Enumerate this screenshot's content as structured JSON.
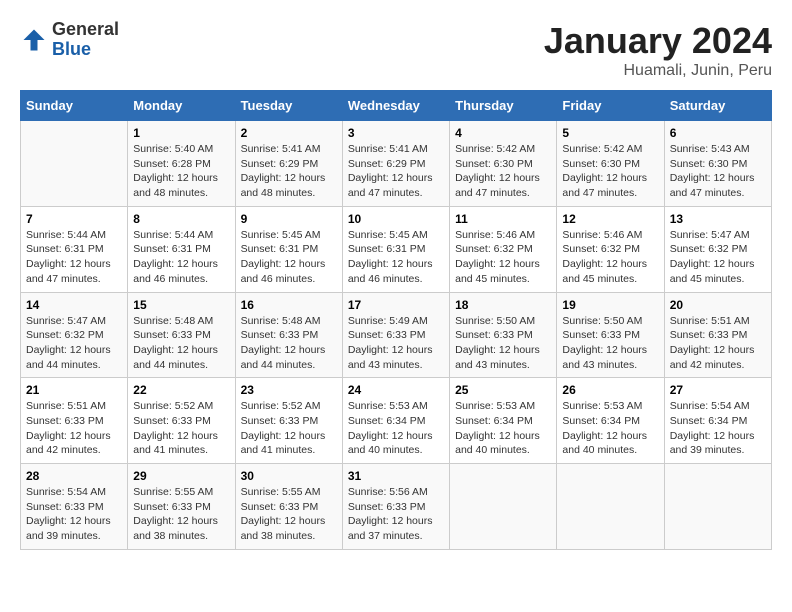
{
  "logo": {
    "general": "General",
    "blue": "Blue"
  },
  "title": "January 2024",
  "subtitle": "Huamali, Junin, Peru",
  "days_of_week": [
    "Sunday",
    "Monday",
    "Tuesday",
    "Wednesday",
    "Thursday",
    "Friday",
    "Saturday"
  ],
  "weeks": [
    [
      {
        "num": "",
        "info": ""
      },
      {
        "num": "1",
        "info": "Sunrise: 5:40 AM\nSunset: 6:28 PM\nDaylight: 12 hours\nand 48 minutes."
      },
      {
        "num": "2",
        "info": "Sunrise: 5:41 AM\nSunset: 6:29 PM\nDaylight: 12 hours\nand 48 minutes."
      },
      {
        "num": "3",
        "info": "Sunrise: 5:41 AM\nSunset: 6:29 PM\nDaylight: 12 hours\nand 47 minutes."
      },
      {
        "num": "4",
        "info": "Sunrise: 5:42 AM\nSunset: 6:30 PM\nDaylight: 12 hours\nand 47 minutes."
      },
      {
        "num": "5",
        "info": "Sunrise: 5:42 AM\nSunset: 6:30 PM\nDaylight: 12 hours\nand 47 minutes."
      },
      {
        "num": "6",
        "info": "Sunrise: 5:43 AM\nSunset: 6:30 PM\nDaylight: 12 hours\nand 47 minutes."
      }
    ],
    [
      {
        "num": "7",
        "info": "Sunrise: 5:44 AM\nSunset: 6:31 PM\nDaylight: 12 hours\nand 47 minutes."
      },
      {
        "num": "8",
        "info": "Sunrise: 5:44 AM\nSunset: 6:31 PM\nDaylight: 12 hours\nand 46 minutes."
      },
      {
        "num": "9",
        "info": "Sunrise: 5:45 AM\nSunset: 6:31 PM\nDaylight: 12 hours\nand 46 minutes."
      },
      {
        "num": "10",
        "info": "Sunrise: 5:45 AM\nSunset: 6:31 PM\nDaylight: 12 hours\nand 46 minutes."
      },
      {
        "num": "11",
        "info": "Sunrise: 5:46 AM\nSunset: 6:32 PM\nDaylight: 12 hours\nand 45 minutes."
      },
      {
        "num": "12",
        "info": "Sunrise: 5:46 AM\nSunset: 6:32 PM\nDaylight: 12 hours\nand 45 minutes."
      },
      {
        "num": "13",
        "info": "Sunrise: 5:47 AM\nSunset: 6:32 PM\nDaylight: 12 hours\nand 45 minutes."
      }
    ],
    [
      {
        "num": "14",
        "info": "Sunrise: 5:47 AM\nSunset: 6:32 PM\nDaylight: 12 hours\nand 44 minutes."
      },
      {
        "num": "15",
        "info": "Sunrise: 5:48 AM\nSunset: 6:33 PM\nDaylight: 12 hours\nand 44 minutes."
      },
      {
        "num": "16",
        "info": "Sunrise: 5:48 AM\nSunset: 6:33 PM\nDaylight: 12 hours\nand 44 minutes."
      },
      {
        "num": "17",
        "info": "Sunrise: 5:49 AM\nSunset: 6:33 PM\nDaylight: 12 hours\nand 43 minutes."
      },
      {
        "num": "18",
        "info": "Sunrise: 5:50 AM\nSunset: 6:33 PM\nDaylight: 12 hours\nand 43 minutes."
      },
      {
        "num": "19",
        "info": "Sunrise: 5:50 AM\nSunset: 6:33 PM\nDaylight: 12 hours\nand 43 minutes."
      },
      {
        "num": "20",
        "info": "Sunrise: 5:51 AM\nSunset: 6:33 PM\nDaylight: 12 hours\nand 42 minutes."
      }
    ],
    [
      {
        "num": "21",
        "info": "Sunrise: 5:51 AM\nSunset: 6:33 PM\nDaylight: 12 hours\nand 42 minutes."
      },
      {
        "num": "22",
        "info": "Sunrise: 5:52 AM\nSunset: 6:33 PM\nDaylight: 12 hours\nand 41 minutes."
      },
      {
        "num": "23",
        "info": "Sunrise: 5:52 AM\nSunset: 6:33 PM\nDaylight: 12 hours\nand 41 minutes."
      },
      {
        "num": "24",
        "info": "Sunrise: 5:53 AM\nSunset: 6:34 PM\nDaylight: 12 hours\nand 40 minutes."
      },
      {
        "num": "25",
        "info": "Sunrise: 5:53 AM\nSunset: 6:34 PM\nDaylight: 12 hours\nand 40 minutes."
      },
      {
        "num": "26",
        "info": "Sunrise: 5:53 AM\nSunset: 6:34 PM\nDaylight: 12 hours\nand 40 minutes."
      },
      {
        "num": "27",
        "info": "Sunrise: 5:54 AM\nSunset: 6:34 PM\nDaylight: 12 hours\nand 39 minutes."
      }
    ],
    [
      {
        "num": "28",
        "info": "Sunrise: 5:54 AM\nSunset: 6:33 PM\nDaylight: 12 hours\nand 39 minutes."
      },
      {
        "num": "29",
        "info": "Sunrise: 5:55 AM\nSunset: 6:33 PM\nDaylight: 12 hours\nand 38 minutes."
      },
      {
        "num": "30",
        "info": "Sunrise: 5:55 AM\nSunset: 6:33 PM\nDaylight: 12 hours\nand 38 minutes."
      },
      {
        "num": "31",
        "info": "Sunrise: 5:56 AM\nSunset: 6:33 PM\nDaylight: 12 hours\nand 37 minutes."
      },
      {
        "num": "",
        "info": ""
      },
      {
        "num": "",
        "info": ""
      },
      {
        "num": "",
        "info": ""
      }
    ]
  ]
}
